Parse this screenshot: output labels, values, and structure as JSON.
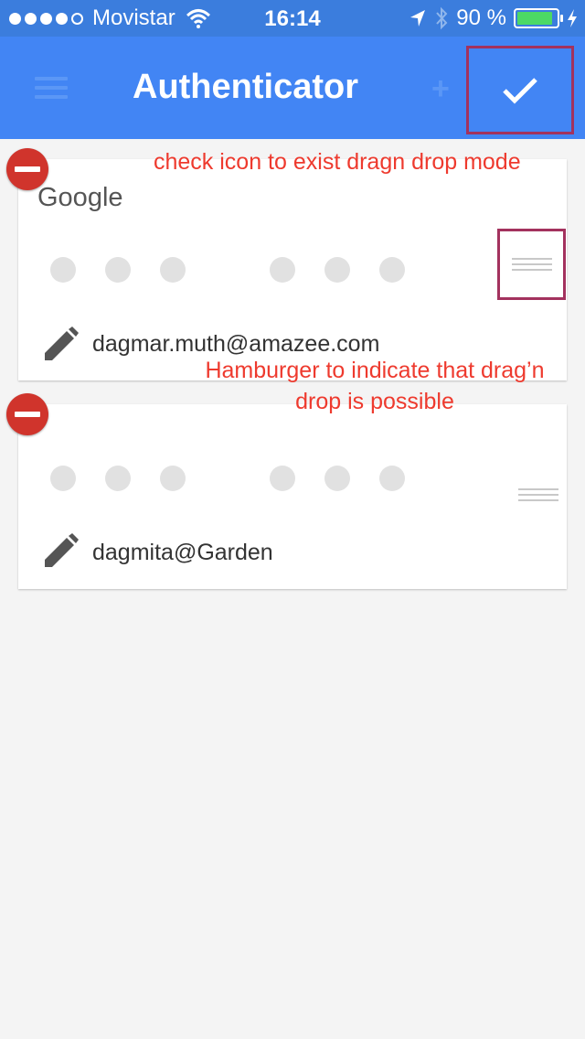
{
  "status_bar": {
    "carrier": "Movistar",
    "time": "16:14",
    "battery": "90 %",
    "battery_level": 0.9,
    "signal_bars": 4,
    "signal_max": 5,
    "icons": [
      "wifi-icon",
      "location-arrow-icon",
      "bluetooth-icon",
      "battery-icon",
      "charging-bolt-icon"
    ]
  },
  "app_bar": {
    "title": "Authenticator",
    "icons": [
      "menu-icon",
      "plus-icon",
      "check-icon"
    ]
  },
  "accounts": [
    {
      "issuer": "Google",
      "user": "dagmar.muth@amazee.com"
    },
    {
      "issuer": "",
      "user": "dagmita@Garden"
    }
  ],
  "annotations": {
    "check_note": "check icon to exist dragn drop mode",
    "hamburger_note_line1": "Hamburger to indicate that drag’n",
    "hamburger_note_line2": "drop is possible",
    "highlight_color": "#a3325e",
    "text_color": "#ee3a2e"
  },
  "colors": {
    "status_bar": "#3b7ddd",
    "app_bar": "#4285f4",
    "delete": "#d0342c",
    "background": "#f4f4f4"
  }
}
